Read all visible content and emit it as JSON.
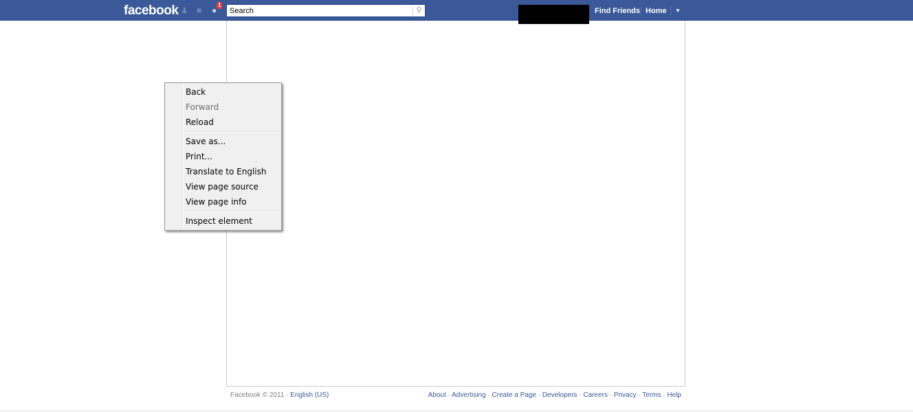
{
  "header": {
    "logo": "facebook",
    "notifications_count": "1",
    "search_placeholder": "Search",
    "find_friends": "Find Friends",
    "home": "Home"
  },
  "footer": {
    "copyright": "Facebook © 2011",
    "language": "English (US)",
    "links": [
      "About",
      "Advertising",
      "Create a Page",
      "Developers",
      "Careers",
      "Privacy",
      "Terms",
      "Help"
    ]
  },
  "context_menu": {
    "back": "Back",
    "forward": "Forward",
    "reload": "Reload",
    "save_as": "Save as...",
    "print": "Print...",
    "translate": "Translate to English",
    "view_source": "View page source",
    "view_info": "View page info",
    "inspect": "Inspect element"
  }
}
